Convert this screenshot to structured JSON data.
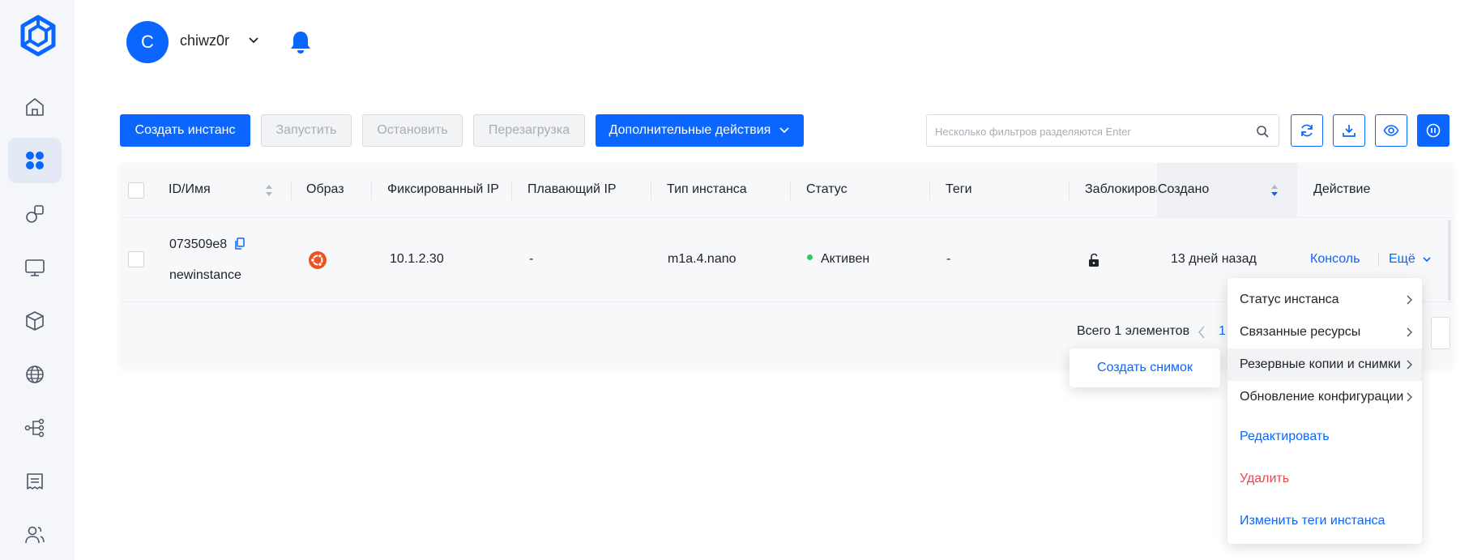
{
  "colors": {
    "primary": "#0a66ff",
    "active_status": "#34c759",
    "danger": "#e5484d",
    "ubuntu": "#e95420"
  },
  "header": {
    "avatar_letter": "C",
    "username": "chiwz0r"
  },
  "toolbar": {
    "create_label": "Создать инстанс",
    "start_label": "Запустить",
    "stop_label": "Остановить",
    "reboot_label": "Перезагрузка",
    "more_label": "Дополнительные действия",
    "search_placeholder": "Несколько фильтров разделяются Enter"
  },
  "table": {
    "columns": [
      "ID/Имя",
      "Образ",
      "Фиксированный IP",
      "Плавающий IP",
      "Тип инстанса",
      "Статус",
      "Теги",
      "Заблокирован",
      "Создано",
      "Действие"
    ],
    "rows": [
      {
        "id": "073509e8",
        "name": "newinstance",
        "image_icon": "ubuntu-icon",
        "fixed_ip": "10.1.2.30",
        "floating_ip": "-",
        "flavor": "m1a.4.nano",
        "status": "Активен",
        "tags": "-",
        "locked_icon": "unlock-icon",
        "created": "13 дней назад",
        "console_label": "Консоль",
        "more_label": "Ещё"
      }
    ]
  },
  "pagination": {
    "total_text": "Всего 1 элементов",
    "current_page": "1"
  },
  "menu": {
    "items": [
      {
        "label": "Статус инстанса"
      },
      {
        "label": "Связанные ресурсы"
      },
      {
        "label": "Резервные копии и снимки"
      },
      {
        "label": "Обновление конфигурации"
      },
      {
        "label": "Редактировать"
      },
      {
        "label": "Удалить"
      },
      {
        "label": "Изменить теги инстанса"
      }
    ],
    "submenu_label": "Создать снимок"
  }
}
